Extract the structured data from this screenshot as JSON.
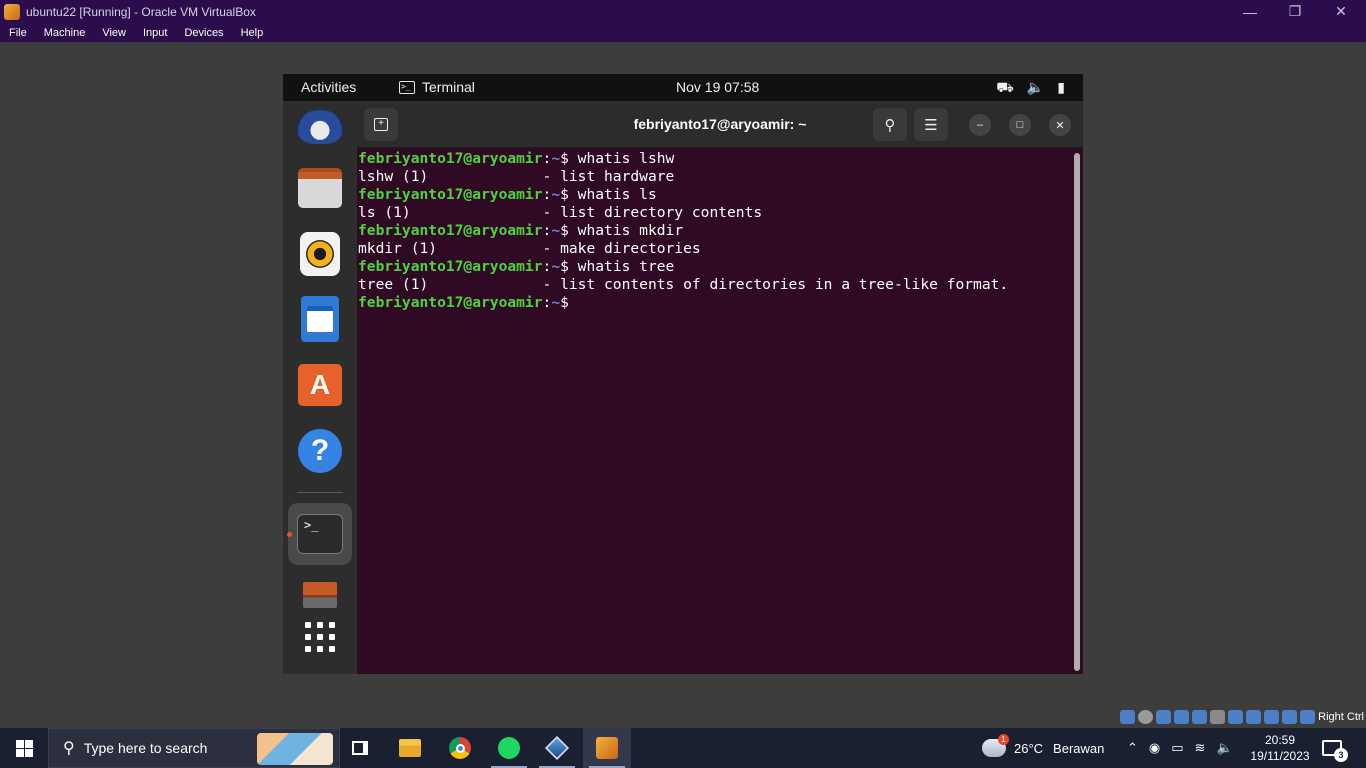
{
  "vbox": {
    "title": "ubuntu22 [Running] - Oracle VM VirtualBox",
    "menu": [
      "File",
      "Machine",
      "View",
      "Input",
      "Devices",
      "Help"
    ],
    "host_key": "Right Ctrl"
  },
  "ubuntu": {
    "activities": "Activities",
    "app_name": "Terminal",
    "clock": "Nov 19  07:58"
  },
  "terminal": {
    "title": "febriyanto17@aryoamir: ~",
    "lines": [
      {
        "user": "febriyanto17@aryoamir",
        "path": "~",
        "cmd": "$ whatis lshw"
      },
      {
        "out": "lshw (1)             - list hardware"
      },
      {
        "user": "febriyanto17@aryoamir",
        "path": "~",
        "cmd": "$ whatis ls"
      },
      {
        "out": "ls (1)               - list directory contents"
      },
      {
        "user": "febriyanto17@aryoamir",
        "path": "~",
        "cmd": "$ whatis mkdir"
      },
      {
        "out": "mkdir (1)            - make directories"
      },
      {
        "user": "febriyanto17@aryoamir",
        "path": "~",
        "cmd": "$ whatis tree"
      },
      {
        "out": "tree (1)             - list contents of directories in a tree-like format."
      },
      {
        "user": "febriyanto17@aryoamir",
        "path": "~",
        "cmd": "$"
      }
    ]
  },
  "taskbar": {
    "search_placeholder": "Type here to search",
    "weather_temp": "26°C",
    "weather_desc": "Berawan",
    "time": "20:59",
    "date": "19/11/2023",
    "notification_count": "3",
    "weather_badge": "1"
  },
  "colors": {
    "terminal_bg": "#300a24",
    "prompt_user": "#4ed43b",
    "prompt_path": "#6e87c8",
    "ubuntu_accent": "#e95420",
    "vbox_title_bg": "#2a0d4a",
    "taskbar_bg": "#1b2031"
  }
}
